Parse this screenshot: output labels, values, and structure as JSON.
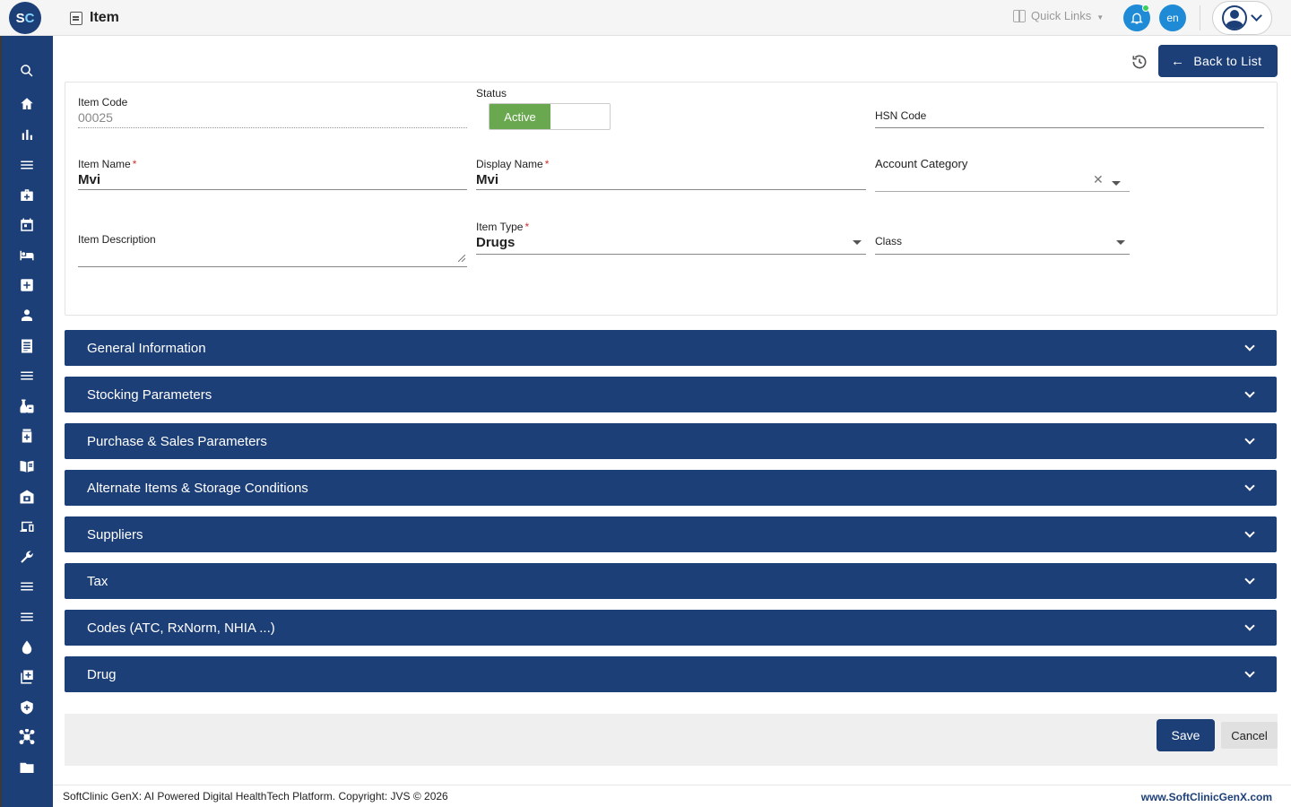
{
  "header": {
    "logo_text_left": "S",
    "logo_text_right": "C",
    "title": "Item",
    "quick_links_label": "Quick Links",
    "language": "en"
  },
  "sidebar": {
    "items": [
      {
        "icon": "search-icon"
      },
      {
        "icon": "home-icon"
      },
      {
        "icon": "bar-chart-icon"
      },
      {
        "icon": "menu-icon"
      },
      {
        "icon": "medical-bag-icon"
      },
      {
        "icon": "calendar-icon"
      },
      {
        "icon": "bed-icon"
      },
      {
        "icon": "medical-plus-icon"
      },
      {
        "icon": "person-icon"
      },
      {
        "icon": "document-list-icon"
      },
      {
        "icon": "menu-icon"
      },
      {
        "icon": "lab-icon"
      },
      {
        "icon": "pharmacy-bottle-icon"
      },
      {
        "icon": "book-icon"
      },
      {
        "icon": "store-icon"
      },
      {
        "icon": "devices-icon"
      },
      {
        "icon": "wrench-icon"
      },
      {
        "icon": "menu-icon"
      },
      {
        "icon": "menu-icon"
      },
      {
        "icon": "blood-drop-icon"
      },
      {
        "icon": "add-box-icon"
      },
      {
        "icon": "shield-icon"
      },
      {
        "icon": "network-icon"
      },
      {
        "icon": "folder-icon"
      }
    ]
  },
  "toolbar": {
    "back_label": "Back to List"
  },
  "form": {
    "item_code": {
      "label": "Item Code",
      "value": "00025"
    },
    "status": {
      "label": "Status",
      "value": "Active"
    },
    "hsn_code": {
      "label": "HSN Code",
      "value": ""
    },
    "item_name": {
      "label": "Item Name",
      "required_mark": "*",
      "value": "Mvi"
    },
    "display_name": {
      "label": "Display Name",
      "required_mark": "*",
      "value": "Mvi"
    },
    "account_category": {
      "label": "Account Category",
      "value": ""
    },
    "item_description": {
      "label": "Item Description",
      "value": ""
    },
    "item_type": {
      "label": "Item Type",
      "required_mark": "*",
      "value": "Drugs"
    },
    "class": {
      "label": "Class",
      "value": ""
    }
  },
  "sections": [
    {
      "label": "General Information"
    },
    {
      "label": "Stocking Parameters"
    },
    {
      "label": "Purchase & Sales Parameters"
    },
    {
      "label": "Alternate Items & Storage Conditions"
    },
    {
      "label": "Suppliers"
    },
    {
      "label": "Tax"
    },
    {
      "label": "Codes (ATC, RxNorm, NHIA ...)"
    },
    {
      "label": "Drug"
    }
  ],
  "actions": {
    "save_label": "Save",
    "cancel_label": "Cancel"
  },
  "footer": {
    "copyright": "SoftClinic GenX: AI Powered Digital HealthTech Platform. Copyright: JVS © 2026",
    "website": "www.SoftClinicGenX.com"
  },
  "colors": {
    "primary": "#1d3f78",
    "status_active": "#6aa84f",
    "header_button": "#1f8bd6"
  }
}
